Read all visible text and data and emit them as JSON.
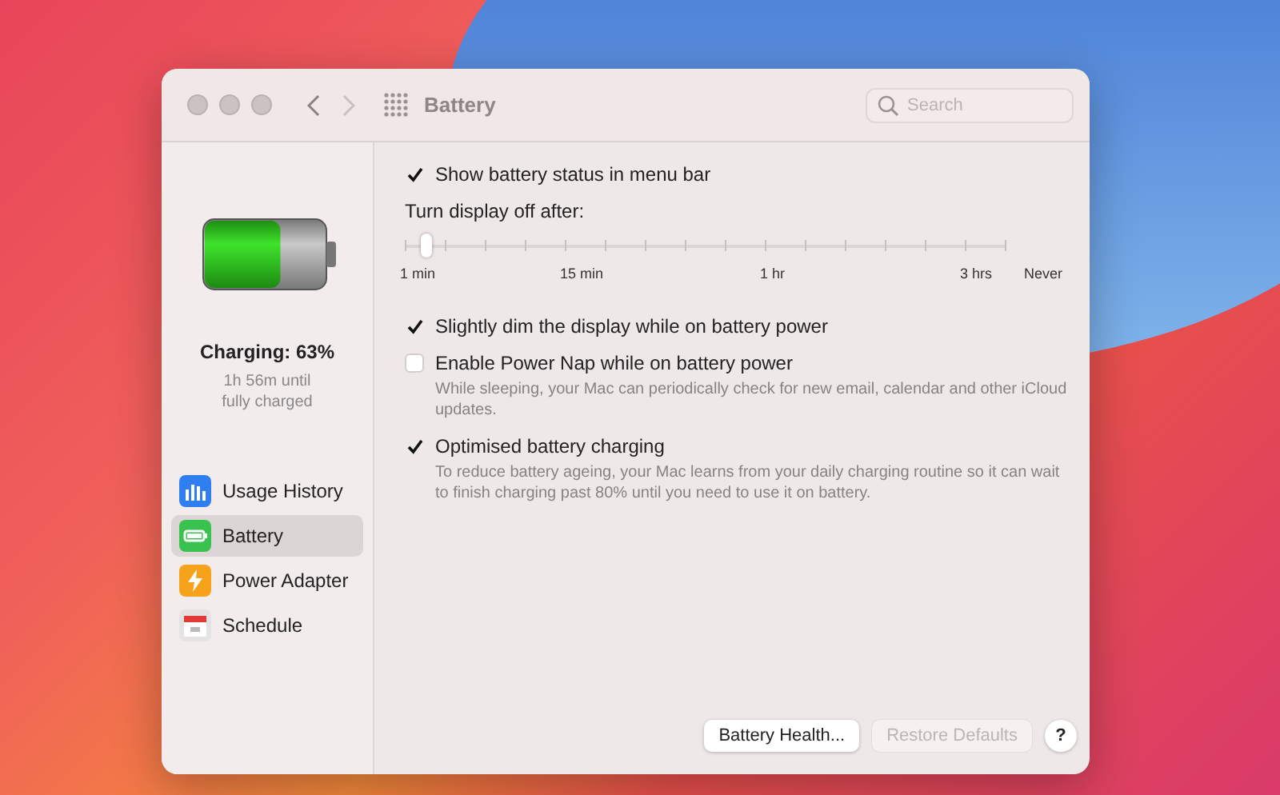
{
  "window": {
    "title": "Battery",
    "search": {
      "placeholder": "Search"
    }
  },
  "sidebar": {
    "status": "Charging: 63%",
    "battery": {
      "level": 0.63
    },
    "estimate": "1h 56m until fully charged",
    "items": [
      {
        "label": "Usage History",
        "kind": "usage",
        "selected": false
      },
      {
        "label": "Battery",
        "kind": "battery",
        "selected": true
      },
      {
        "label": "Power Adapter",
        "kind": "adapter",
        "selected": false
      },
      {
        "label": "Schedule",
        "kind": "schedule",
        "selected": false
      }
    ]
  },
  "settings": [
    {
      "kind": "checkbox",
      "label": "Show battery status in menu bar",
      "checked": true
    },
    {
      "kind": "slider",
      "label": "Turn display off after:",
      "level": 0.035,
      "ticks": [
        "1 min",
        "15 min",
        "1 hr",
        "3 hrs",
        "Never"
      ]
    },
    {
      "kind": "checkbox",
      "label": "Slightly dim the display while on battery power",
      "checked": true
    },
    {
      "kind": "checkbox",
      "label": "Enable Power Nap while on battery power",
      "checked": false,
      "description": "While sleeping, your Mac can periodically check for new email, calendar and other iCloud updates."
    },
    {
      "kind": "checkbox",
      "label": "Optimised battery charging",
      "checked": true,
      "description": "To reduce battery ageing, your Mac learns from your daily charging routine so it can wait to finish charging past 80% until you need to use it on battery."
    }
  ],
  "buttons": [
    {
      "label": "Battery Health...",
      "disabled": false
    },
    {
      "label": "Restore Defaults",
      "disabled": true
    },
    {
      "label": "?",
      "disabled": false
    }
  ]
}
